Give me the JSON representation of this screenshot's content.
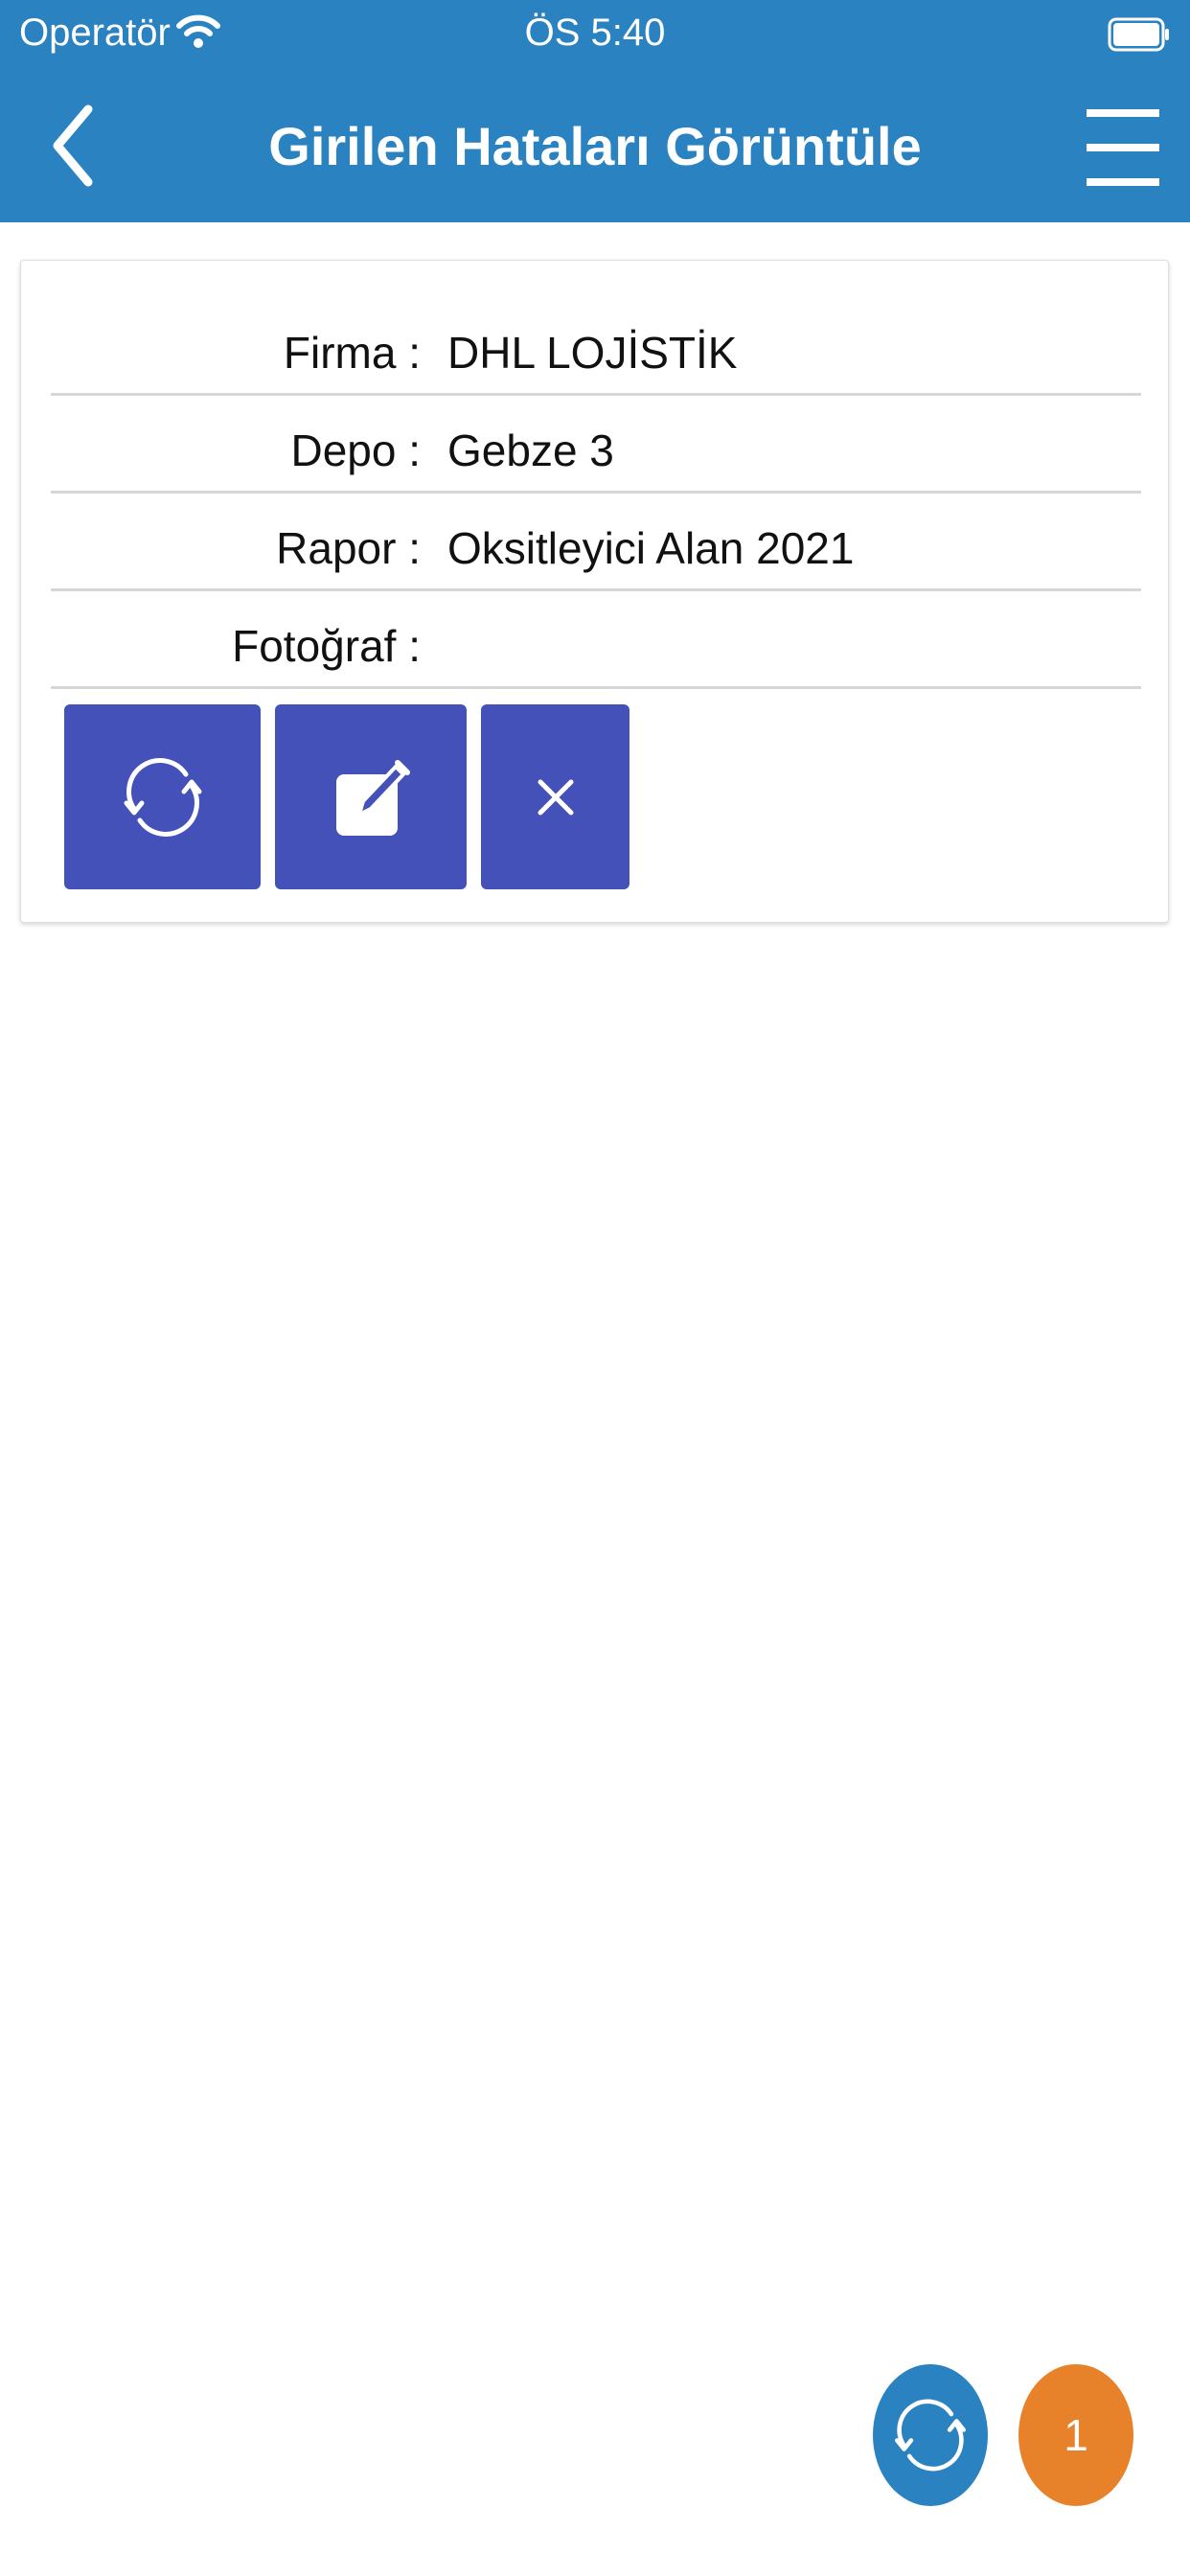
{
  "status_bar": {
    "carrier": "Operatör",
    "time": "ÖS 5:40"
  },
  "header": {
    "title": "Girilen Hataları Görüntüle"
  },
  "record": {
    "rows": [
      {
        "label": "Firma :",
        "value": "DHL LOJİSTİK"
      },
      {
        "label": "Depo :",
        "value": "Gebze 3"
      },
      {
        "label": "Rapor :",
        "value": "Oksitleyici Alan 2021"
      },
      {
        "label": "Fotoğraf :",
        "value": ""
      }
    ],
    "actions": [
      {
        "name": "refresh-record-button",
        "icon": "refresh-icon"
      },
      {
        "name": "edit-record-button",
        "icon": "edit-icon"
      },
      {
        "name": "delete-record-button",
        "icon": "close-icon"
      }
    ]
  },
  "fab": {
    "refresh_icon": "refresh-icon",
    "count": "1"
  },
  "colors": {
    "primary": "#2a82c0",
    "action": "#4451b8",
    "badge": "#e8822a"
  }
}
